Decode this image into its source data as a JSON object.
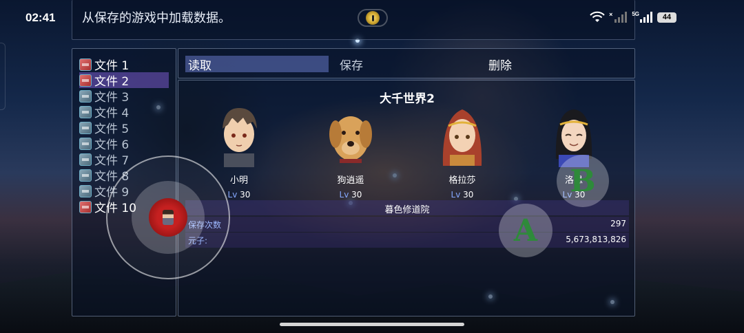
{
  "status_bar": {
    "time": "02:41",
    "network_tag": "5G",
    "battery": "44",
    "icons": [
      "wifi-icon",
      "signal-icon",
      "signal-5g-icon",
      "battery-icon"
    ]
  },
  "help": {
    "text": "从保存的游戏中加载数据。",
    "camera_icon": "camera-indicator-icon"
  },
  "file_list": {
    "items": [
      {
        "label": "文件 1",
        "has_data": true
      },
      {
        "label": "文件 2",
        "has_data": true,
        "selected": true
      },
      {
        "label": "文件 3",
        "has_data": false
      },
      {
        "label": "文件 4",
        "has_data": false
      },
      {
        "label": "文件 5",
        "has_data": false
      },
      {
        "label": "文件 6",
        "has_data": false
      },
      {
        "label": "文件 7",
        "has_data": false
      },
      {
        "label": "文件 8",
        "has_data": false
      },
      {
        "label": "文件 9",
        "has_data": false
      },
      {
        "label": "文件 10",
        "has_data": true
      }
    ]
  },
  "commands": {
    "load": "读取",
    "save": "保存",
    "delete": "删除"
  },
  "save_info": {
    "title": "大千世界2",
    "actors": [
      {
        "name": "小明",
        "level_tag": "Lv",
        "level": "30"
      },
      {
        "name": "狗逍遥",
        "level_tag": "Lv",
        "level": "30"
      },
      {
        "name": "格拉莎",
        "level_tag": "Lv",
        "level": "30"
      },
      {
        "name": "洛思",
        "level_tag": "Lv",
        "level": "30"
      }
    ],
    "location": "暮色修道院",
    "save_count_label": "保存次数",
    "save_count": "297",
    "gold_label": "元子:",
    "gold": "5,673,813,826"
  },
  "controls": {
    "button_a": "A",
    "button_b": "B"
  },
  "colors": {
    "selected_file": "#7a5ac8",
    "active_command": "#7a8ce6",
    "level_tag": "#86a9ff",
    "button_letter": "#2e8a3a"
  }
}
